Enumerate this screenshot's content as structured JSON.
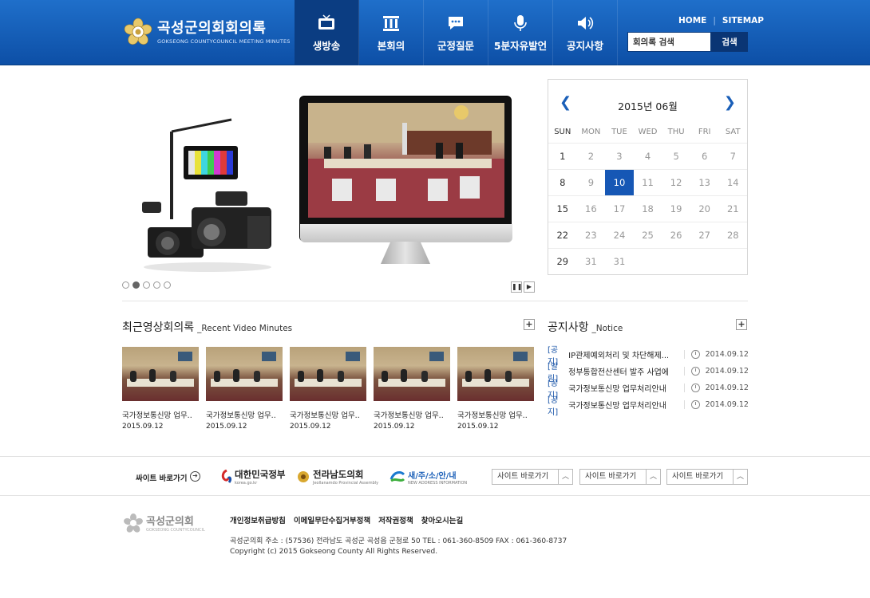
{
  "header": {
    "logo_title": "곡성군의회회의록",
    "logo_sub": "GOKSEONG COUNTYCOUNCIL MEETING MINUTES",
    "nav": [
      {
        "label": "생방송",
        "icon": "tv-icon",
        "active": true
      },
      {
        "label": "본회의",
        "icon": "building-icon",
        "active": false
      },
      {
        "label": "군정질문",
        "icon": "chat-icon",
        "active": false
      },
      {
        "label": "5분자유발언",
        "icon": "microphone-icon",
        "active": false
      },
      {
        "label": "공지사항",
        "icon": "speaker-icon",
        "active": false
      }
    ],
    "util": {
      "home": "HOME",
      "sitemap": "SITEMAP"
    },
    "search": {
      "value": "회의록 검색",
      "button": "검색"
    }
  },
  "calendar": {
    "title": "2015년 06월",
    "days_of_week": [
      "SUN",
      "MON",
      "TUE",
      "WED",
      "THU",
      "FRI",
      "SAT"
    ],
    "weeks": [
      [
        "1",
        "2",
        "3",
        "4",
        "5",
        "6",
        "7"
      ],
      [
        "8",
        "9",
        "10",
        "11",
        "12",
        "13",
        "14"
      ],
      [
        "15",
        "16",
        "17",
        "18",
        "19",
        "20",
        "21"
      ],
      [
        "22",
        "23",
        "24",
        "25",
        "26",
        "27",
        "28"
      ],
      [
        "29",
        "31",
        "31",
        "",
        "",
        "",
        ""
      ]
    ],
    "today": "10"
  },
  "slider": {
    "dots": 5,
    "active_dot": 2
  },
  "recent": {
    "title": "최근영상회의록",
    "subtitle": "_Recent Video Minutes",
    "items": [
      {
        "title": "국가정보통신망 업무..",
        "date": "2015.09.12"
      },
      {
        "title": "국가정보통신망 업무..",
        "date": "2015.09.12"
      },
      {
        "title": "국가정보통신망 업무..",
        "date": "2015.09.12"
      },
      {
        "title": "국가정보통신망 업무..",
        "date": "2015.09.12"
      },
      {
        "title": "국가정보통신망 업무..",
        "date": "2015.09.12"
      }
    ]
  },
  "notice": {
    "title": "공지사항",
    "subtitle": "_Notice",
    "items": [
      {
        "tag": "[공지]",
        "text": "IP관제예외처리 및 차단해제...",
        "date": "2014.09.12"
      },
      {
        "tag": "[알림]",
        "text": "정부통합전산센터 발주 사업에...",
        "date": "2014.09.12"
      },
      {
        "tag": "[공지]",
        "text": "국가정보통신망 업무처리안내",
        "date": "2014.09.12"
      },
      {
        "tag": "[공지]",
        "text": "국가정보통신망 업무처리안내",
        "date": "2014.09.12"
      }
    ]
  },
  "sites": {
    "label": "싸이트 바로가기",
    "banners": [
      {
        "name": "대한민국정부",
        "sub": "korea.go.kr"
      },
      {
        "name": "전라남도의회",
        "sub": "Jeollanamdo Provincial Assembly"
      },
      {
        "name": "새/주/소/안/내",
        "sub": "NEW ADDRESS INFORMATION"
      }
    ],
    "selects": [
      "사이트 바로가기",
      "사이트 바로가기",
      "사이트 바로가기"
    ]
  },
  "footer": {
    "logo_name": "곡성군의회",
    "logo_sub": "GOKSEONG COUNTYCOUNCIL",
    "links": [
      "개인정보취급방침",
      "이메일무단수집거부정책",
      "저작권정책",
      "찾아오시는길"
    ],
    "address": "곡성군의회   주소 : (57536) 전라남도 곡성군 곡성읍 군청로 50   TEL : 061-360-8509   FAX : 061-360-8737",
    "copyright": "Copyright (c) 2015 Gokseong County All Rights Reserved."
  },
  "colors": {
    "brand_blue": "#1657b5",
    "header_dark": "#0b3d82",
    "notice_tag": "#1a55a8"
  }
}
